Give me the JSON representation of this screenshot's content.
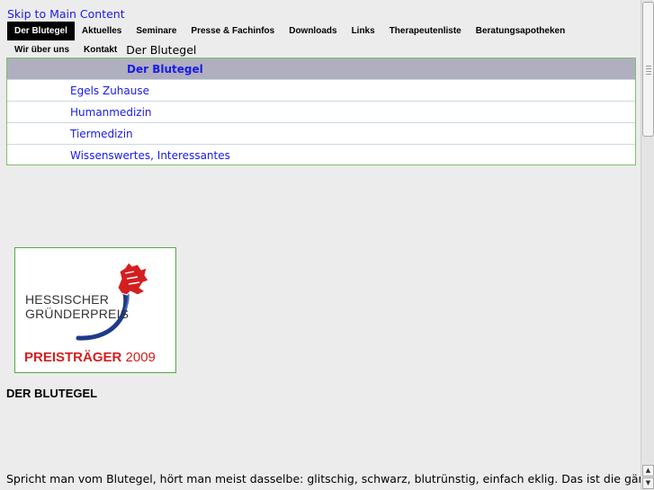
{
  "skip_link": "Skip to Main Content",
  "nav": {
    "row1": [
      "Der Blutegel",
      "Aktuelles",
      "Seminare",
      "Presse & Fachinfos",
      "Downloads",
      "Links",
      "Therapeutenliste",
      "Beratungsapotheken"
    ],
    "row2": [
      "Wir über uns",
      "Kontakt"
    ],
    "active": "Der Blutegel",
    "current": "Der Blutegel"
  },
  "subnav": {
    "header": "Der Blutegel",
    "items": [
      "Egels Zuhause",
      "Humanmedizin",
      "Tiermedizin",
      "Wissenswertes, Interessantes"
    ]
  },
  "badge": {
    "line1": "HESSISCHER",
    "line2": "GRÜNDERPREIS",
    "award_word": "PREISTRÄGER",
    "award_year": "2009"
  },
  "page_heading": "DER BLUTEGEL",
  "intro_text": "Spricht man vom Blutegel, hört man meist dasselbe: glitschig, schwarz, blutrünstig, einfach eklig. Das ist die gängige",
  "colors": {
    "link": "#1a1ae8",
    "border_green": "#7fbf6a",
    "subnav_header_bg": "#afafbf",
    "award_red": "#d41f1f"
  }
}
